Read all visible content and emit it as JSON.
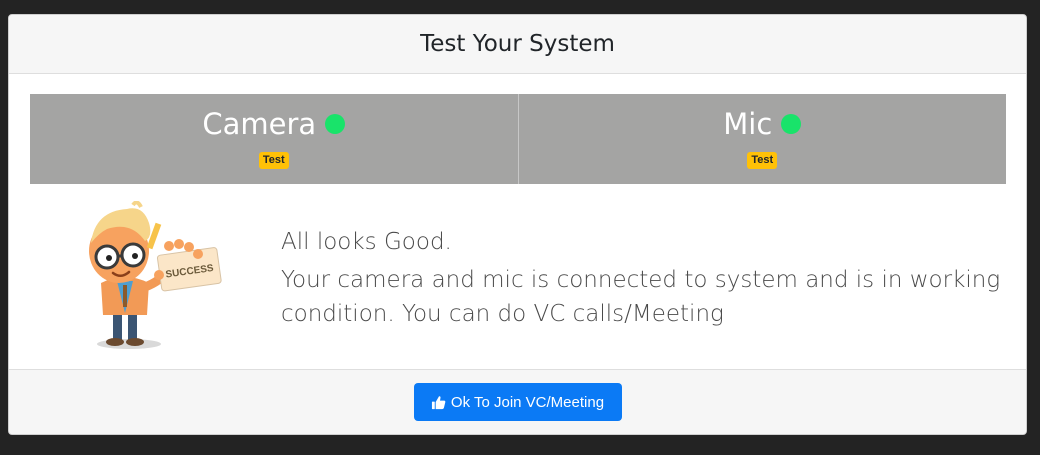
{
  "modal": {
    "title": "Test Your System"
  },
  "devices": [
    {
      "name": "Camera",
      "status": "ok",
      "badge": "Test"
    },
    {
      "name": "Mic",
      "status": "ok",
      "badge": "Test"
    }
  ],
  "illustration": {
    "sign_text": "SUCCESS",
    "icon": "success-character-illustration"
  },
  "message": {
    "title": "All looks Good.",
    "body": "Your camera and mic is connected to system and is in working condition. You can do VC calls/Meeting"
  },
  "footer": {
    "ok_label": "Ok To Join VC/Meeting",
    "ok_icon": "thumbs-up-icon"
  },
  "colors": {
    "device_bg": "#a4a4a3",
    "status_ok": "#19e36a",
    "badge": "#ffc107",
    "primary": "#0b7af5"
  }
}
